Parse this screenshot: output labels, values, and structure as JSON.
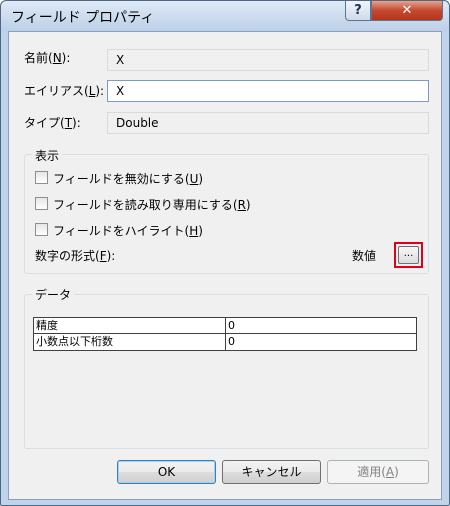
{
  "window": {
    "title": "フィールド プロパティ",
    "help_label": "?",
    "close_label": "✕"
  },
  "fields": {
    "name_label_pre": "名前(",
    "name_label_key": "N",
    "name_label_post": "):",
    "name_value": "X",
    "alias_label_pre": "エイリアス(",
    "alias_label_key": "L",
    "alias_label_post": "):",
    "alias_value": "X",
    "type_label_pre": "タイプ(",
    "type_label_key": "T",
    "type_label_post": "):",
    "type_value": "Double"
  },
  "display_group": {
    "title": "表示",
    "checkboxes": [
      {
        "pre": "フィールドを無効にする(",
        "key": "U",
        "post": ")",
        "checked": false
      },
      {
        "pre": "フィールドを読み取り専用にする(",
        "key": "R",
        "post": ")",
        "checked": false
      },
      {
        "pre": "フィールドをハイライト(",
        "key": "H",
        "post": ")",
        "checked": false
      }
    ],
    "number_format_pre": "数字の形式(",
    "number_format_key": "F",
    "number_format_post": "):",
    "number_format_value": "数値",
    "ellipsis_label": "..."
  },
  "data_group": {
    "title": "データ",
    "rows": [
      {
        "name": "精度",
        "value": "0"
      },
      {
        "name": "小数点以下桁数",
        "value": "0"
      }
    ]
  },
  "buttons": {
    "ok": "OK",
    "cancel": "キャンセル",
    "apply_pre": "適用(",
    "apply_key": "A",
    "apply_post": ")"
  },
  "colors": {
    "highlight": "#e0001a",
    "close_button": "#c24a30"
  }
}
